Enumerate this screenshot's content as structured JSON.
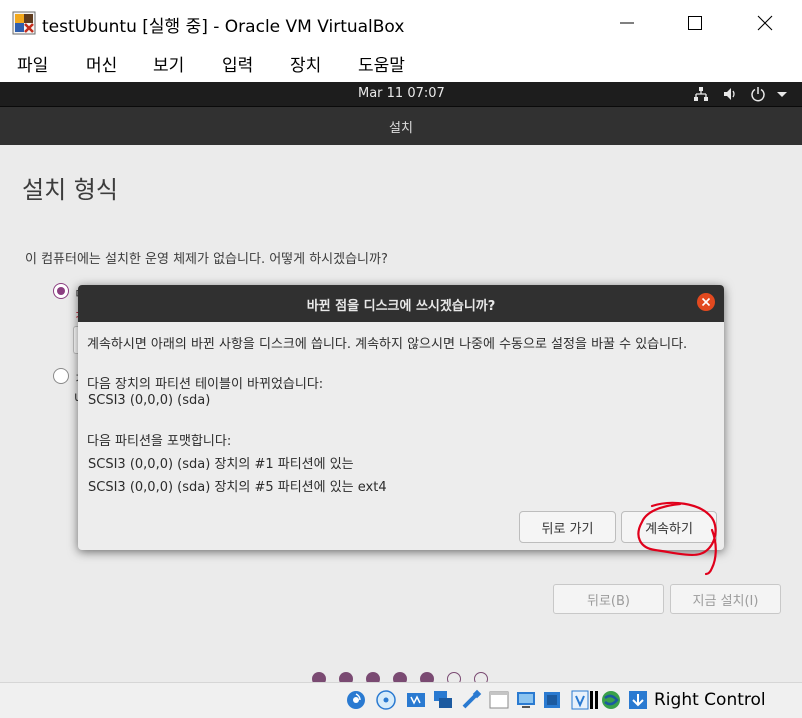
{
  "window": {
    "title": "testUbuntu [실행 중] - Oracle VM VirtualBox"
  },
  "menubar": {
    "items": [
      {
        "label": "파일"
      },
      {
        "label": "머신"
      },
      {
        "label": "보기"
      },
      {
        "label": "입력"
      },
      {
        "label": "장치"
      },
      {
        "label": "도움말"
      }
    ]
  },
  "guest": {
    "topbar": {
      "clock": "Mar 11  07:07"
    },
    "header": {
      "title": "설치"
    },
    "page": {
      "title": "설치 형식",
      "question": "이 컴퓨터에는 설치한 운영 체제가 없습니다. 어떻게 하시겠습니까?",
      "fragments": {
        "opt1_a": "ㄷ",
        "opt1_b": "ㅊ",
        "opt2_a": "ㅈ",
        "opt2_b": "u"
      },
      "back_button": "뒤로(B)",
      "install_button": "지금 설치(I)",
      "progress": {
        "total": 7,
        "current": 5
      }
    },
    "dialog": {
      "title": "바뀐 점을 디스크에 쓰시겠습니까?",
      "message": "계속하시면 아래의 바뀐 사항을 디스크에 씁니다. 계속하지 않으시면 나중에 수동으로 설정을 바꿀 수 있습니다.",
      "partition_table_heading": "다음 장치의 파티션 테이블이 바뀌었습니다:",
      "partition_table_device": "SCSI3 (0,0,0) (sda)",
      "format_heading": "다음 파티션을 포맷합니다:",
      "format_items": [
        "SCSI3 (0,0,0) (sda) 장치의 #1 파티션에 있는",
        "SCSI3 (0,0,0) (sda) 장치의 #5 파티션에 있는 ext4"
      ],
      "back_button": "뒤로 가기",
      "continue_button": "계속하기"
    }
  },
  "statusbar": {
    "host_key": "Right Control"
  },
  "colors": {
    "ubuntu_accent": "#8b3e80",
    "close_orange": "#e2491f",
    "annotation_red": "#e0001b"
  }
}
